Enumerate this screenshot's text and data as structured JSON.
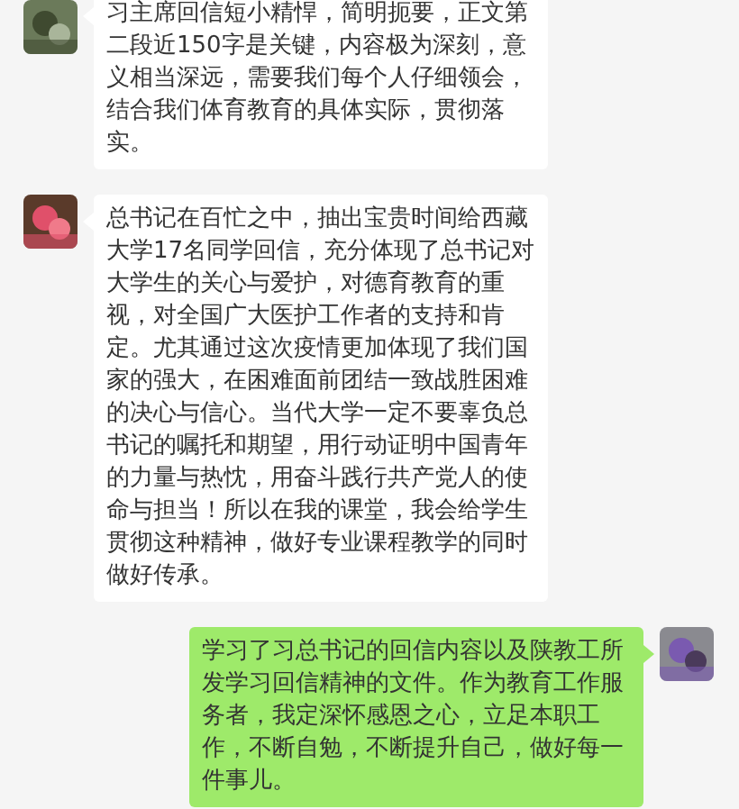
{
  "messages": [
    {
      "kind": "incoming",
      "text": "习主席回信短小精悍，简明扼要，正文第二段近150字是关键，内容极为深刻，意义相当深远，需要我们每个人仔细领会，结合我们体育教育的具体实际，贯彻落实。"
    },
    {
      "kind": "incoming",
      "text": "总书记在百忙之中，抽出宝贵时间给西藏大学17名同学回信，充分体现了总书记对大学生的关心与爱护，对德育教育的重视，对全国广大医护工作者的支持和肯定。尤其通过这次疫情更加体现了我们国家的强大，在困难面前团结一致战胜困难的决心与信心。当代大学一定不要辜负总书记的嘱托和期望，用行动证明中国青年的力量与热忱，用奋斗践行共产党人的使命与担当！所以在我的课堂，我会给学生贯彻这种精神，做好专业课程教学的同时做好传承。"
    },
    {
      "kind": "outgoing",
      "text": "学习了习总书记的回信内容以及陕教工所发学习回信精神的文件。作为教育工作服务者，我定深怀感恩之心，立足本职工作，不断自勉，不断提升自己，做好每一件事儿。"
    }
  ]
}
